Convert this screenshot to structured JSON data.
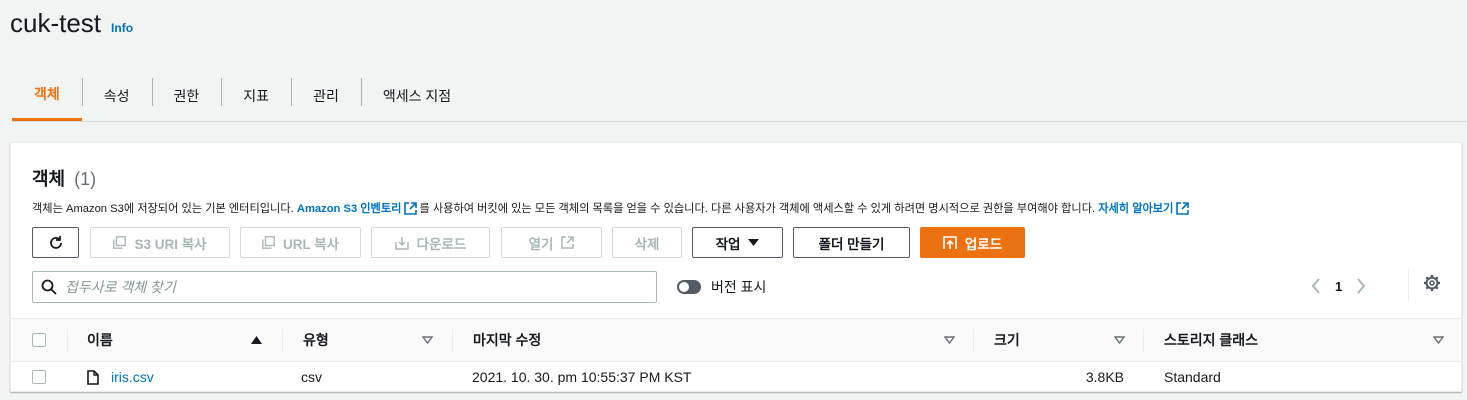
{
  "header": {
    "title": "cuk-test",
    "info": "Info"
  },
  "tabs": [
    {
      "label": "객체",
      "active": true
    },
    {
      "label": "속성"
    },
    {
      "label": "권한"
    },
    {
      "label": "지표"
    },
    {
      "label": "관리"
    },
    {
      "label": "액세스 지점"
    }
  ],
  "panel": {
    "title": "객체",
    "count": "(1)",
    "desc_part1": "객체는 Amazon S3에 저장되어 있는 기본 엔터티입니다.",
    "inventory_link": "Amazon S3 인벤토리",
    "desc_part2": "를 사용하여 버킷에 있는 모든 객체의 목록을 얻을 수 있습니다. 다른 사용자가 객체에 액세스할 수 있게 하려면 명시적으로 권한을 부여해야 합니다.",
    "learn_more": "자세히 알아보기"
  },
  "toolbar": {
    "copy_s3_uri": "S3 URI 복사",
    "copy_url": "URL 복사",
    "download": "다운로드",
    "open": "열기",
    "delete": "삭제",
    "actions": "작업",
    "create_folder": "폴더 만들기",
    "upload": "업로드"
  },
  "search": {
    "placeholder": "접두사로 객체 찾기"
  },
  "versions_toggle": {
    "label": "버전 표시",
    "on": false
  },
  "pagination": {
    "current_page": "1"
  },
  "table": {
    "columns": {
      "name": "이름",
      "type": "유형",
      "modified": "마지막 수정",
      "size": "크기",
      "storage": "스토리지 클래스"
    },
    "rows": [
      {
        "name": "iris.csv",
        "type": "csv",
        "modified": "2021. 10. 30. pm 10:55:37 PM KST",
        "size": "3.8KB",
        "storage": "Standard"
      }
    ]
  },
  "colors": {
    "accent": "#ec7211",
    "link": "#0073bb",
    "border": "#d5dbdb",
    "disabled": "#aab7b8"
  }
}
